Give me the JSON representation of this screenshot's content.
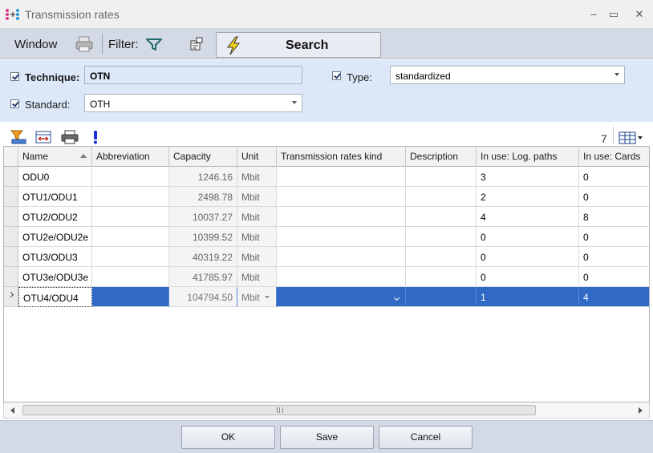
{
  "window": {
    "title": "Transmission rates",
    "minimize": "–",
    "maximize": "▭",
    "close": "✕"
  },
  "toolbar": {
    "window_label": "Window",
    "filter_label": "Filter:",
    "search_label": "Search"
  },
  "filters": {
    "technique": {
      "label": "Technique:",
      "value": "OTN",
      "checked": true
    },
    "type": {
      "label": "Type:",
      "value": "standardized",
      "checked": true
    },
    "standard": {
      "label": "Standard:",
      "value": "OTH",
      "checked": true
    }
  },
  "grid": {
    "row_count": "7",
    "columns": [
      "Name",
      "Abbreviation",
      "Capacity",
      "Unit",
      "Transmission rates kind",
      "Description",
      "In use: Log. paths",
      "In use: Cards"
    ],
    "sorted_column": "Name",
    "rows": [
      {
        "name": "ODU0",
        "abbreviation": "",
        "capacity": "1246.16",
        "unit": "Mbit",
        "kind": "",
        "description": "",
        "log_paths": "3",
        "cards": "0"
      },
      {
        "name": "OTU1/ODU1",
        "abbreviation": "",
        "capacity": "2498.78",
        "unit": "Mbit",
        "kind": "",
        "description": "",
        "log_paths": "2",
        "cards": "0"
      },
      {
        "name": "OTU2/ODU2",
        "abbreviation": "",
        "capacity": "10037.27",
        "unit": "Mbit",
        "kind": "",
        "description": "",
        "log_paths": "4",
        "cards": "8"
      },
      {
        "name": "OTU2e/ODU2e",
        "abbreviation": "",
        "capacity": "10399.52",
        "unit": "Mbit",
        "kind": "",
        "description": "",
        "log_paths": "0",
        "cards": "0"
      },
      {
        "name": "OTU3/ODU3",
        "abbreviation": "",
        "capacity": "40319.22",
        "unit": "Mbit",
        "kind": "",
        "description": "",
        "log_paths": "0",
        "cards": "0"
      },
      {
        "name": "OTU3e/ODU3e",
        "abbreviation": "",
        "capacity": "41785.97",
        "unit": "Mbit",
        "kind": "",
        "description": "",
        "log_paths": "0",
        "cards": "0"
      },
      {
        "name": "OTU4/ODU4",
        "abbreviation": "",
        "capacity": "104794.50",
        "unit": "Mbit",
        "kind": "",
        "description": "",
        "log_paths": "1",
        "cards": "4",
        "selected": true
      }
    ]
  },
  "footer": {
    "ok_label": "OK",
    "save_label": "Save",
    "cancel_label": "Cancel"
  },
  "colors": {
    "selection": "#3169c6",
    "toolbar_bg": "#d4d9e6",
    "filter_bg": "#dce8f8",
    "search_bolt": "#f2d31b"
  },
  "icons": [
    "app-icon",
    "printer-icon",
    "funnel-filter-icon",
    "properties-icon",
    "lightning-bolt-icon",
    "clear-filter-icon",
    "column-width-icon",
    "print-grid-icon",
    "exclamation-icon",
    "column-chooser-icon"
  ]
}
